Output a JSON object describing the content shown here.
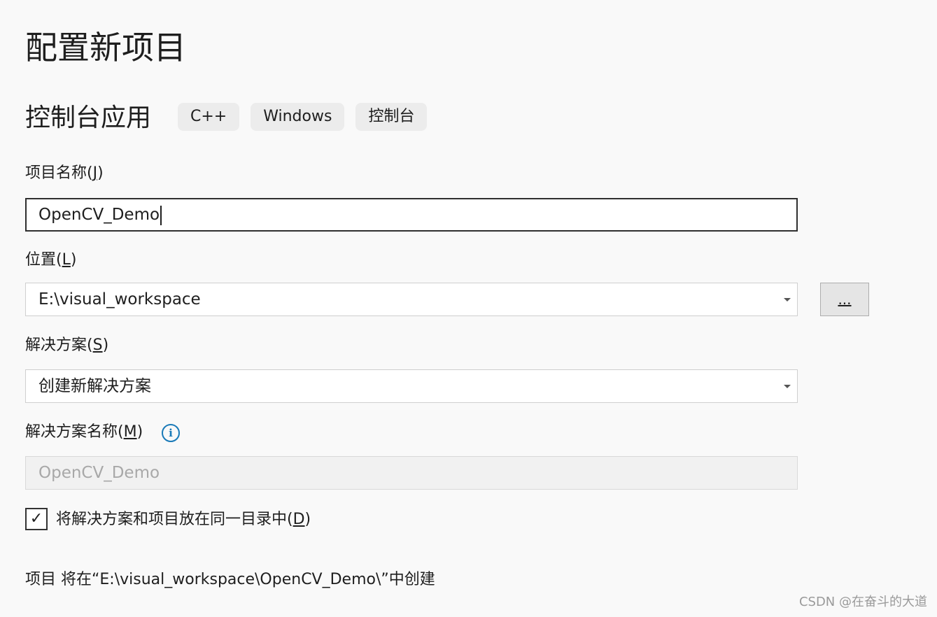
{
  "page": {
    "title": "配置新项目",
    "template_name": "控制台应用",
    "tags": [
      "C++",
      "Windows",
      "控制台"
    ]
  },
  "project_name": {
    "label": "项目名称(",
    "mnemonic": "J",
    "label_suffix": ")",
    "value": "OpenCV_Demo"
  },
  "location": {
    "label": "位置(",
    "mnemonic": "L",
    "label_suffix": ")",
    "value": "E:\\visual_workspace",
    "browse_label": "..."
  },
  "solution": {
    "label": "解决方案(",
    "mnemonic": "S",
    "label_suffix": ")",
    "value": "创建新解决方案"
  },
  "solution_name": {
    "label": "解决方案名称(",
    "mnemonic": "M",
    "label_suffix": ")",
    "info_icon": "i",
    "value": "OpenCV_Demo"
  },
  "same_directory": {
    "checked_glyph": "✓",
    "label": "将解决方案和项目放在同一目录中(",
    "mnemonic": "D",
    "label_suffix": ")"
  },
  "summary_text": "项目 将在“E:\\visual_workspace\\OpenCV_Demo\\”中创建",
  "watermark": "CSDN @在奋斗的大道"
}
